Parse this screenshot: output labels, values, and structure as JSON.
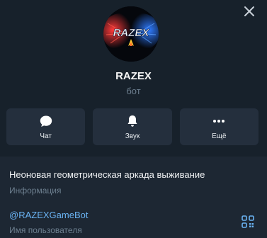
{
  "window": {
    "close_icon": "close-icon"
  },
  "profile": {
    "avatar_text": "RAZEX",
    "name": "RAZEX",
    "subtitle": "бот"
  },
  "actions": [
    {
      "label": "Чат",
      "icon": "chat-bubble-icon"
    },
    {
      "label": "Звук",
      "icon": "bell-icon"
    },
    {
      "label": "Ещё",
      "icon": "more-dots-icon"
    }
  ],
  "info": {
    "description": "Неоновая геометрическая аркада выживание",
    "description_caption": "Информация",
    "username": "@RAZEXGameBot",
    "username_caption": "Имя пользователя",
    "qr_icon": "qr-code-icon"
  },
  "colors": {
    "background": "#17212b",
    "card": "#242f3d",
    "info_background": "#1d2733",
    "link": "#6ab3f3",
    "muted": "#6d7f8f"
  }
}
